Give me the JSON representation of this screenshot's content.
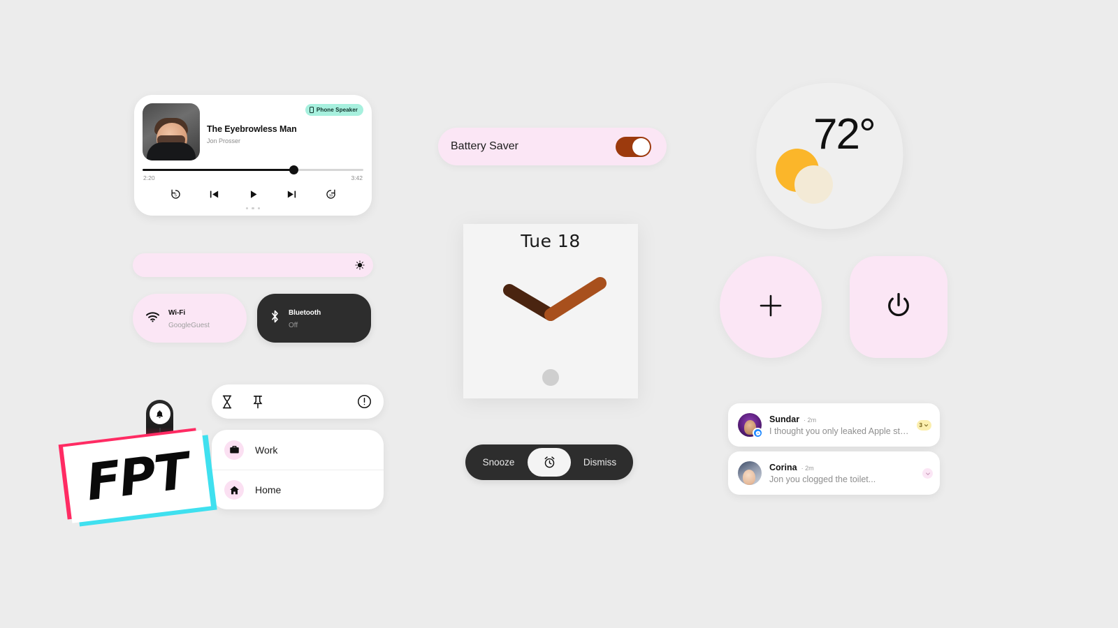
{
  "theme": {
    "background": "#ececec",
    "pink_surface": "#fbe6f5",
    "dark_surface": "#2d2d2d",
    "white_surface": "#ffffff",
    "mint_chip": "#a7f0de",
    "toggle_on": "#9c3a0d",
    "clock_hand_hour": "#4a2410",
    "clock_hand_minute": "#a8501d",
    "sun": "#fbb62a",
    "cloud": "#f3ead6",
    "badge_yellow": "#fbeeae"
  },
  "media_player": {
    "title": "The Eyebrowless Man",
    "artist": "Jon Prosser",
    "output_chip": "Phone Speaker",
    "output_chip_icon": "phone-icon",
    "time_current": "2:20",
    "time_total": "3:42",
    "progress_percent": 68.5,
    "album_art_icon": "album-art-thumbnail",
    "controls": [
      {
        "name": "replay-5-icon",
        "label": "5"
      },
      {
        "name": "skip-previous-icon",
        "label": ""
      },
      {
        "name": "play-icon",
        "label": ""
      },
      {
        "name": "skip-next-icon",
        "label": ""
      },
      {
        "name": "forward-30-icon",
        "label": "30"
      }
    ],
    "page_dots": 3
  },
  "brightness": {
    "icon": "brightness-icon",
    "value_percent": 100
  },
  "tiles": [
    {
      "name": "wifi",
      "icon": "wifi-icon",
      "label": "Wi-Fi",
      "sub": "GoogleGuest",
      "state": "on"
    },
    {
      "name": "bluetooth",
      "icon": "bluetooth-icon",
      "label": "Bluetooth",
      "sub": "Off",
      "state": "off"
    }
  ],
  "notification_actions": [
    {
      "name": "snooze-hourglass-icon",
      "label": "Snooze"
    },
    {
      "name": "pin-icon",
      "label": "Pin"
    },
    {
      "name": "info-icon",
      "label": "Info"
    }
  ],
  "shortcuts": [
    {
      "icon": "briefcase-icon",
      "label": "Work"
    },
    {
      "icon": "home-icon",
      "label": "Home"
    }
  ],
  "fpt_logo": {
    "text": "FPT",
    "pin_icon": "bell-icon"
  },
  "battery_saver": {
    "label": "Battery Saver",
    "toggle_state": "on"
  },
  "clock": {
    "date": "Tue 18",
    "hour_angle_deg": -125,
    "minute_angle_deg": -55,
    "crown_icon": "clock-crown-dot"
  },
  "alarm": {
    "snooze_label": "Snooze",
    "dismiss_label": "Dismiss",
    "center_icon": "alarm-clock-icon"
  },
  "weather": {
    "temperature": "72°",
    "icon": "sun-behind-cloud-icon"
  },
  "action_buttons": [
    {
      "name": "add-button",
      "icon": "plus-icon",
      "shape": "circle"
    },
    {
      "name": "power-button",
      "icon": "power-icon",
      "shape": "rounded-square"
    }
  ],
  "notifications": [
    {
      "name": "Sundar",
      "time": "· 2m",
      "message": "I thought you only leaked Apple stuff...",
      "count": "3",
      "app_badge": "messenger-icon",
      "avatar": "avatar-sundar"
    },
    {
      "name": "Corina",
      "time": "· 2m",
      "message": "Jon you clogged the toilet...",
      "count": "",
      "app_badge": "",
      "avatar": "avatar-corina"
    }
  ]
}
